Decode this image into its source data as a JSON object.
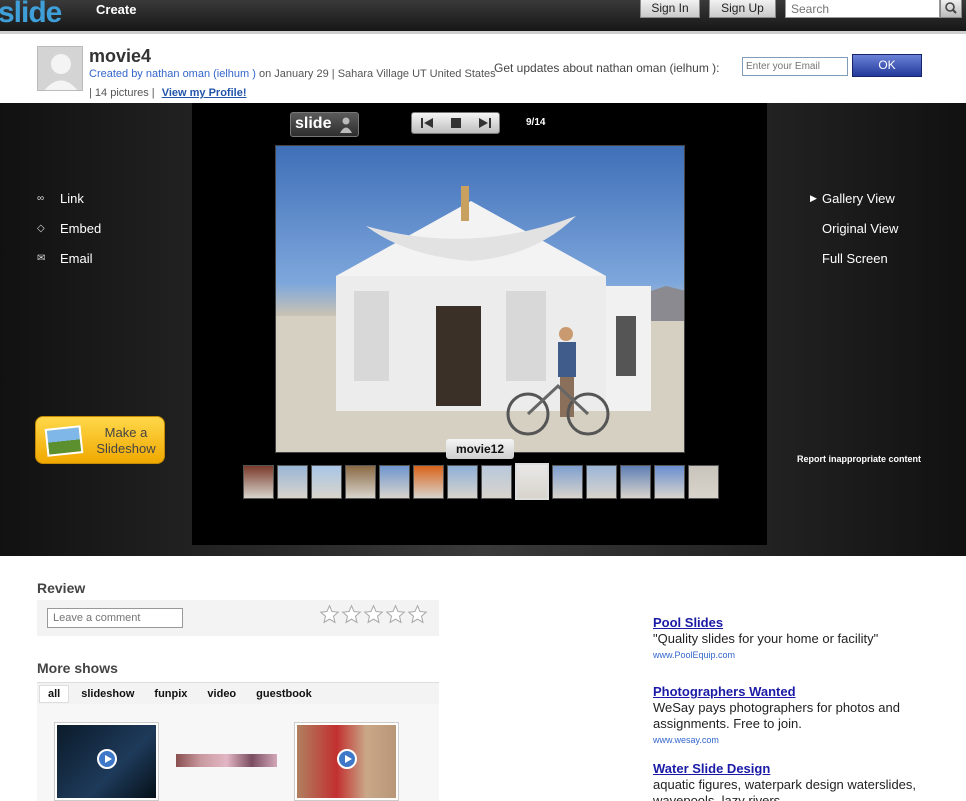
{
  "topbar": {
    "logo": "slide",
    "create": "Create",
    "sign_in": "Sign In",
    "sign_up": "Sign Up",
    "search_placeholder": "Search"
  },
  "header": {
    "title": "movie4",
    "created_by": "Created by nathan oman (ielhum )",
    "date": "on January 29",
    "location": "Sahara Village UT United States",
    "pictures": "14 pictures",
    "view_profile": "View my Profile!",
    "updates_label": "Get updates about nathan oman (ielhum ):",
    "email_placeholder": "Enter your Email",
    "ok": "OK"
  },
  "player": {
    "logo": "slide",
    "counter": "9/14",
    "caption": "movie12",
    "left_links": [
      {
        "label": "Link",
        "icon": "link-icon"
      },
      {
        "label": "Embed",
        "icon": "embed-icon"
      },
      {
        "label": "Email",
        "icon": "email-icon"
      }
    ],
    "right_links": [
      "Gallery View",
      "Original View",
      "Full Screen"
    ],
    "make_slideshow": "Make a Slideshow",
    "report": "Report inappropriate content",
    "thumbnails": [
      {
        "color": "#7a3a2a"
      },
      {
        "color": "#9ab6d6"
      },
      {
        "color": "#a9c6e6"
      },
      {
        "color": "#8b6a44"
      },
      {
        "color": "#6f96cf"
      },
      {
        "color": "#d9631a"
      },
      {
        "color": "#8fb0d8"
      },
      {
        "color": "#b8c8dc"
      },
      {
        "color": "#e8e8e8"
      },
      {
        "color": "#7f9fcf"
      },
      {
        "color": "#9cb6d8"
      },
      {
        "color": "#5f7fb5"
      },
      {
        "color": "#6a8fd0"
      },
      {
        "color": "#c8c4bc"
      }
    ],
    "selected_index": 8
  },
  "review": {
    "heading": "Review",
    "comment_placeholder": "Leave a comment",
    "rating_stars": 5
  },
  "more_shows": {
    "heading": "More shows",
    "tabs": [
      "all",
      "slideshow",
      "funpix",
      "video",
      "guestbook"
    ]
  },
  "ads": [
    {
      "title": "Pool Slides",
      "text": "\"Quality slides for your home or facility\"",
      "url": "www.PoolEquip.com"
    },
    {
      "title": "Photographers Wanted",
      "text": "WeSay pays photographers for photos and assignments. Free to join.",
      "url": "www.wesay.com"
    },
    {
      "title": "Water Slide Design",
      "text": "aquatic figures, waterpark design waterslides, wavepools, lazy rivers",
      "url": ""
    }
  ]
}
